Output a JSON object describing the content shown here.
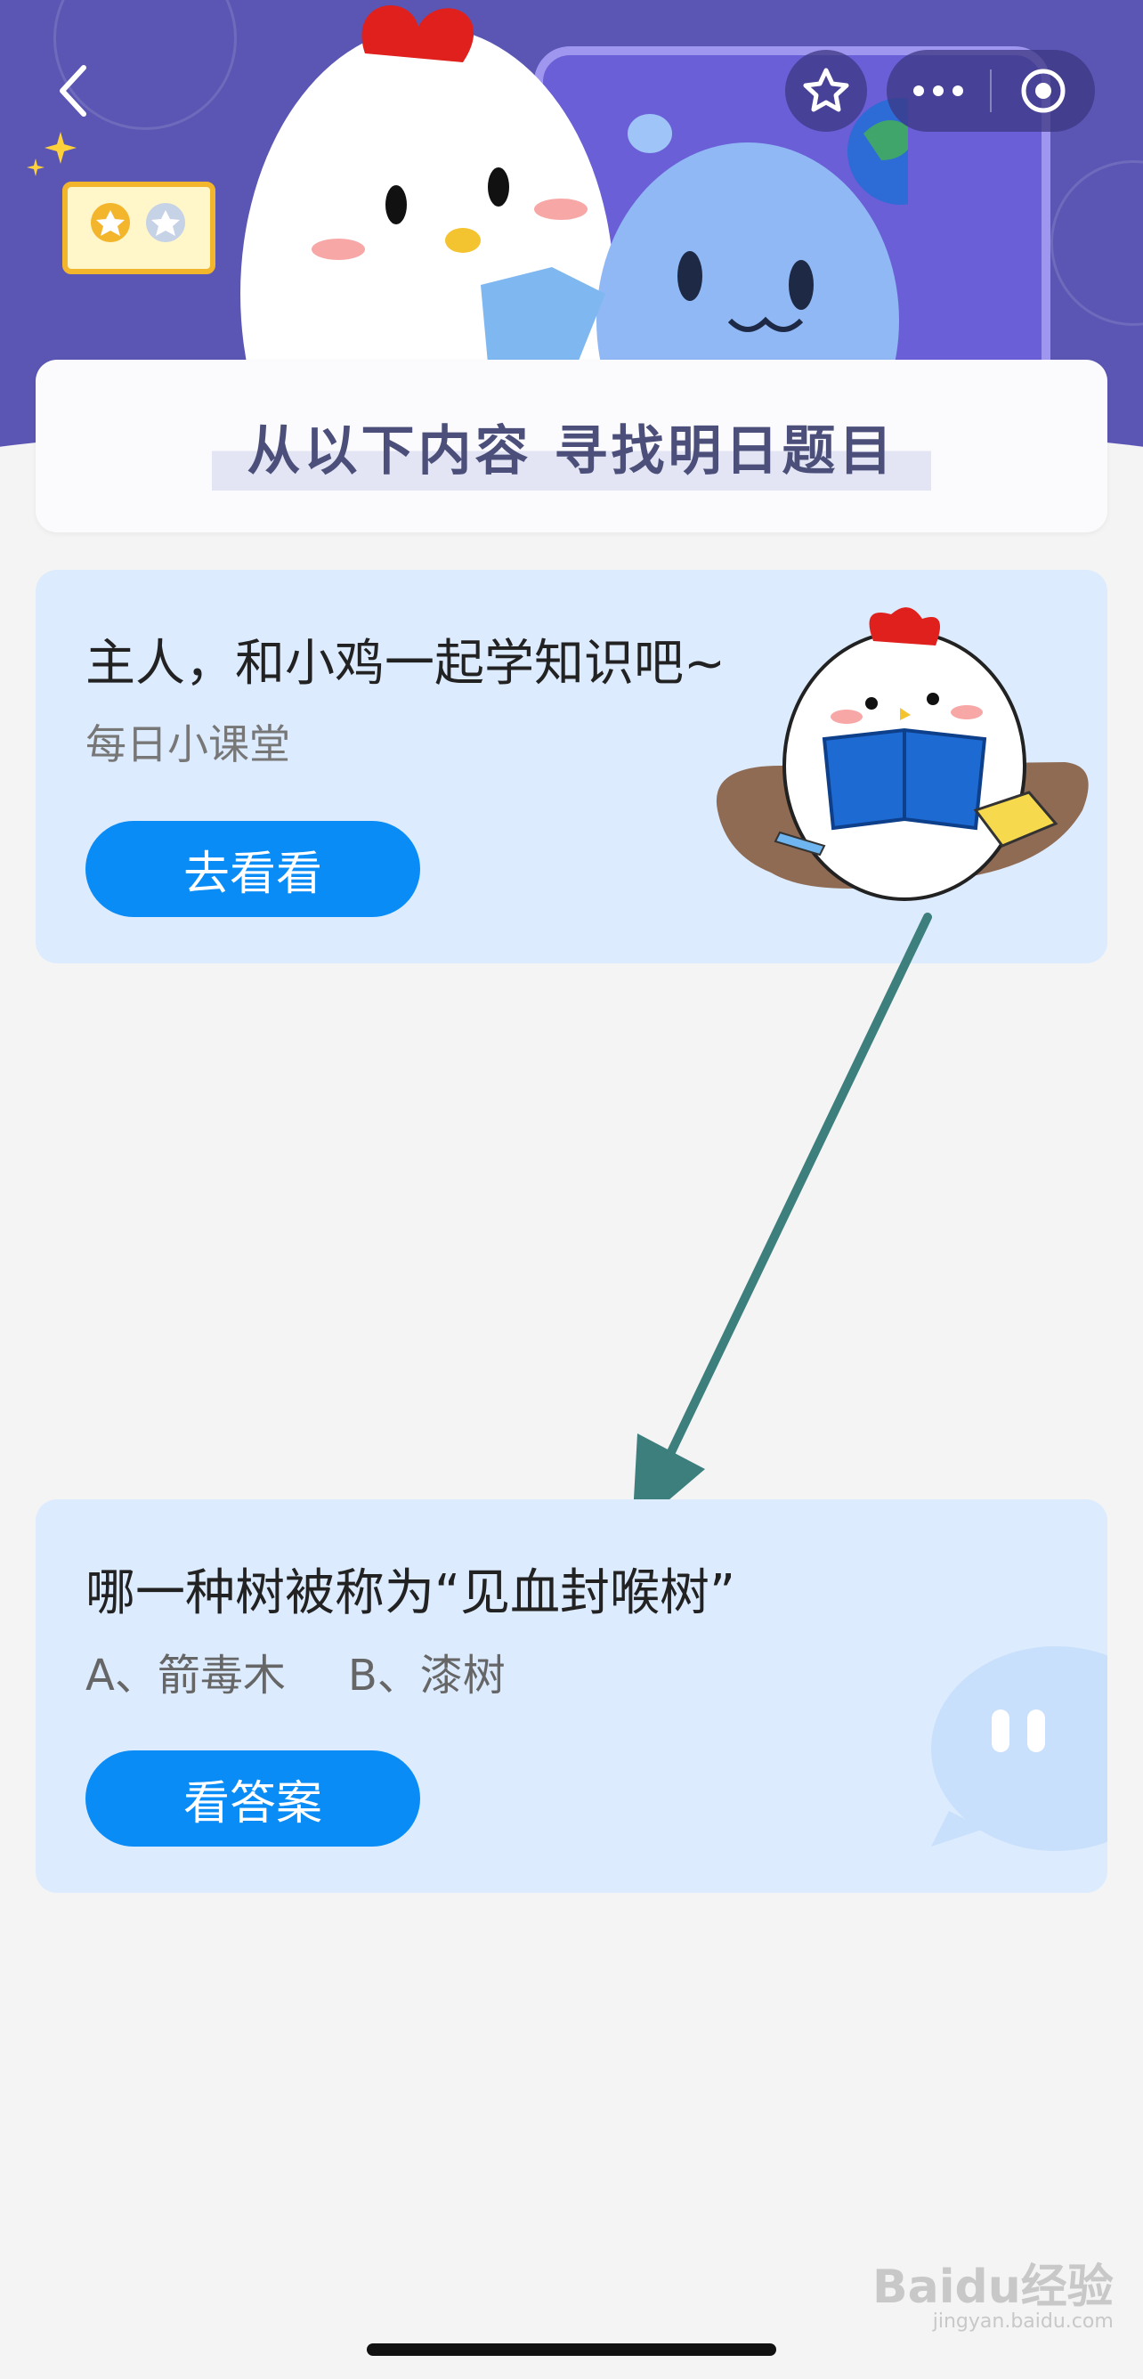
{
  "header": {
    "back_icon": "chevron-left-icon",
    "favorite_icon": "star-icon",
    "more_icon": "more-dots-icon",
    "close_icon": "target-circle-icon"
  },
  "banner": {
    "title": "从以下内容  寻找明日题目"
  },
  "lesson_card": {
    "title": "主人，和小鸡一起学知识吧~",
    "subtitle": "每日小课堂",
    "button_label": "去看看"
  },
  "question_card": {
    "question": "哪一种树被称为“见血封喉树”",
    "option_a": "A、箭毒木",
    "option_b": "B、漆树",
    "button_label": "看答案"
  },
  "watermark": {
    "text": "Baidu经验",
    "url": "jingyan.baidu.com"
  },
  "colors": {
    "hero_bg": "#5b56b3",
    "card_bg": "#dcebfe",
    "button_blue": "#0a8cf6",
    "arrow": "#3d7f7d"
  }
}
